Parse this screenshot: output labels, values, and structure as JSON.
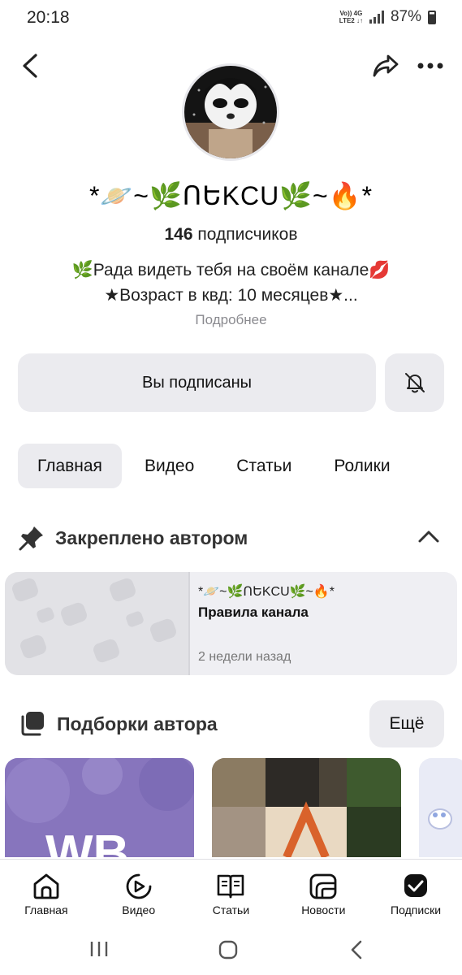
{
  "status": {
    "time": "20:18",
    "network_top": "Vo)) 4G",
    "network_bottom": "LTE2 ↓↑",
    "battery": "87%"
  },
  "topbar": {
    "back_icon": "arrow-left-icon",
    "share_icon": "share-arrow-icon",
    "more_icon": "dots-horizontal-icon"
  },
  "channel": {
    "name": "*🪐~🌿ՈԵKCU🌿~🔥*",
    "subscribers_count": "146",
    "subscribers_label": "подписчиков",
    "description_line1": "🌿Рада видеть тебя на своём канале💋",
    "description_line2": "★Возраст в квд: 10 месяцев★...",
    "more_link": "Подробнее"
  },
  "actions": {
    "subscribed_label": "Вы подписаны",
    "bell_icon": "bell-off-icon"
  },
  "tabs": [
    {
      "label": "Главная",
      "active": true
    },
    {
      "label": "Видео",
      "active": false
    },
    {
      "label": "Статьи",
      "active": false
    },
    {
      "label": "Ролики",
      "active": false
    }
  ],
  "pinned": {
    "header": "Закреплено автором",
    "card": {
      "channel": "*🪐~🌿ՈԵKCU🌿~🔥*",
      "title": "Правила канала",
      "time": "2 недели назад"
    }
  },
  "collections": {
    "header": "Подборки автора",
    "more_label": "Ещё",
    "first_card_text": "WB"
  },
  "bottom_nav": [
    {
      "label": "Главная",
      "icon": "home-icon"
    },
    {
      "label": "Видео",
      "icon": "video-play-icon"
    },
    {
      "label": "Статьи",
      "icon": "articles-book-icon"
    },
    {
      "label": "Новости",
      "icon": "news-icon"
    },
    {
      "label": "Подписки",
      "icon": "subscriptions-icon"
    }
  ],
  "system_nav": {
    "recents_icon": "recents-icon",
    "home_icon": "home-circle-icon",
    "back_icon": "system-back-icon"
  },
  "colors": {
    "button_bg": "#ebebef",
    "card_bg": "#efeff3",
    "muted_text": "#8a8a8f"
  }
}
